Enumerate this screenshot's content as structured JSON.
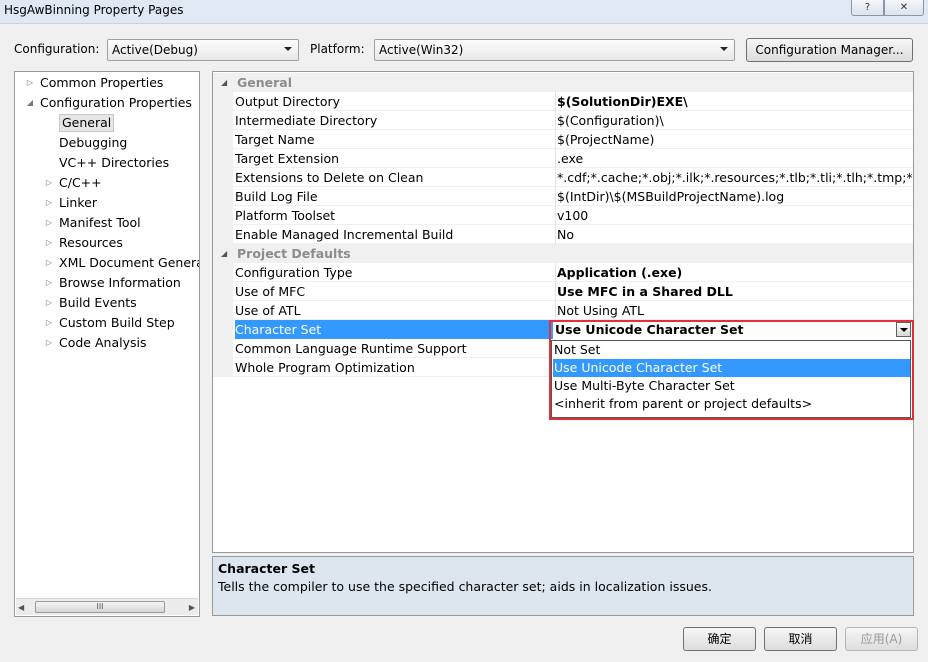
{
  "window": {
    "title": "HsgAwBinning Property Pages",
    "help_label": "?",
    "close_label": "✕"
  },
  "toolbar": {
    "configuration_label": "Configuration:",
    "configuration_value": "Active(Debug)",
    "platform_label": "Platform:",
    "platform_value": "Active(Win32)",
    "config_manager_label": "Configuration Manager..."
  },
  "tree": {
    "items": [
      {
        "label": "Common Properties",
        "expander": "▷"
      },
      {
        "label": "Configuration Properties",
        "expander": "◢"
      },
      {
        "label": "General",
        "selected": true
      },
      {
        "label": "Debugging"
      },
      {
        "label": "VC++ Directories"
      },
      {
        "label": "C/C++",
        "expander": "▷"
      },
      {
        "label": "Linker",
        "expander": "▷"
      },
      {
        "label": "Manifest Tool",
        "expander": "▷"
      },
      {
        "label": "Resources",
        "expander": "▷"
      },
      {
        "label": "XML Document Generat",
        "expander": "▷"
      },
      {
        "label": "Browse Information",
        "expander": "▷"
      },
      {
        "label": "Build Events",
        "expander": "▷"
      },
      {
        "label": "Custom Build Step",
        "expander": "▷"
      },
      {
        "label": "Code Analysis",
        "expander": "▷"
      }
    ],
    "scroll_left": "◀",
    "scroll_right": "▶",
    "scroll_thumb": "III"
  },
  "grid": {
    "categories": [
      {
        "name": "General",
        "toggle": "◢",
        "rows": [
          {
            "name": "Output Directory",
            "value": "$(SolutionDir)EXE\\",
            "bold": true
          },
          {
            "name": "Intermediate Directory",
            "value": "$(Configuration)\\"
          },
          {
            "name": "Target Name",
            "value": "$(ProjectName)"
          },
          {
            "name": "Target Extension",
            "value": ".exe"
          },
          {
            "name": "Extensions to Delete on Clean",
            "value": "*.cdf;*.cache;*.obj;*.ilk;*.resources;*.tlb;*.tli;*.tlh;*.tmp;*.rsp;*.pgc"
          },
          {
            "name": "Build Log File",
            "value": "$(IntDir)\\$(MSBuildProjectName).log"
          },
          {
            "name": "Platform Toolset",
            "value": "v100"
          },
          {
            "name": "Enable Managed Incremental Build",
            "value": "No"
          }
        ]
      },
      {
        "name": "Project Defaults",
        "toggle": "◢",
        "rows": [
          {
            "name": "Configuration Type",
            "value": "Application (.exe)",
            "bold": true
          },
          {
            "name": "Use of MFC",
            "value": "Use MFC in a Shared DLL",
            "bold": true
          },
          {
            "name": "Use of ATL",
            "value": "Not Using ATL"
          },
          {
            "name": "Character Set",
            "value": "Use Unicode Character Set",
            "bold": true,
            "selected": true
          },
          {
            "name": "Common Language Runtime Support",
            "value": ""
          },
          {
            "name": "Whole Program Optimization",
            "value": ""
          }
        ]
      }
    ],
    "dropdown": {
      "current": "Use Unicode Character Set",
      "options": [
        "Not Set",
        "Use Unicode Character Set",
        "Use Multi-Byte Character Set",
        "<inherit from parent or project defaults>"
      ],
      "highlighted_index": 1,
      "highlight_color": "#3399ff",
      "annotation_color": "#e0303a"
    }
  },
  "description": {
    "title": "Character Set",
    "text": "Tells the compiler to use the specified character set; aids in localization issues."
  },
  "buttons": {
    "ok": "确定",
    "cancel": "取消",
    "apply": "应用(A)"
  }
}
